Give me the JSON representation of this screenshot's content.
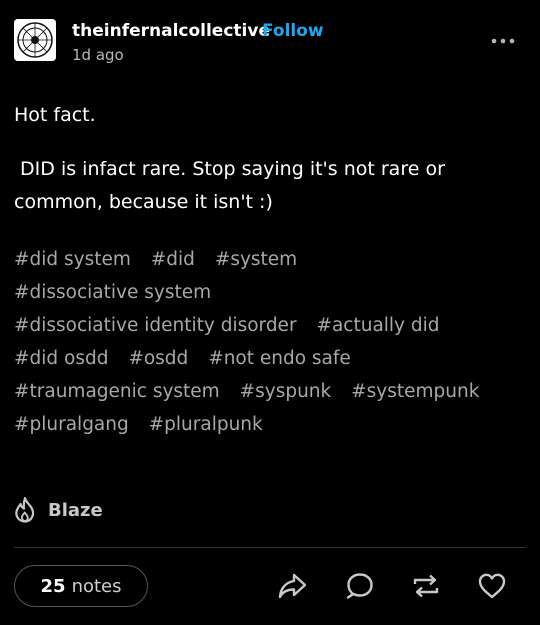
{
  "header": {
    "username": "theinfernalcollective",
    "follow_label": "Follow",
    "timestamp": "1d ago"
  },
  "post": {
    "paragraphs": [
      "Hot fact.",
      " DID is infact rare. Stop saying it's not rare or common, because it isn't :)"
    ],
    "tags": [
      "#did system",
      "#did",
      "#system",
      "#dissociative system",
      "#dissociative identity disorder",
      "#actually did",
      "#did osdd",
      "#osdd",
      "#not endo safe",
      "#traumagenic system",
      "#syspunk",
      "#systempunk",
      "#pluralgang",
      "#pluralpunk"
    ]
  },
  "footer": {
    "blaze_label": "Blaze",
    "notes_count": "25",
    "notes_label": "notes"
  },
  "icons": {
    "more": "more-dots-icon",
    "blaze": "flame-icon",
    "share": "share-arrow-icon",
    "reply": "reply-bubble-icon",
    "reblog": "reblog-icon",
    "like": "heart-icon"
  },
  "colors": {
    "background": "#000000",
    "follow": "#1aa8f0",
    "tag_text": "#a8a8a8",
    "muted_text": "#b8b8b8"
  }
}
